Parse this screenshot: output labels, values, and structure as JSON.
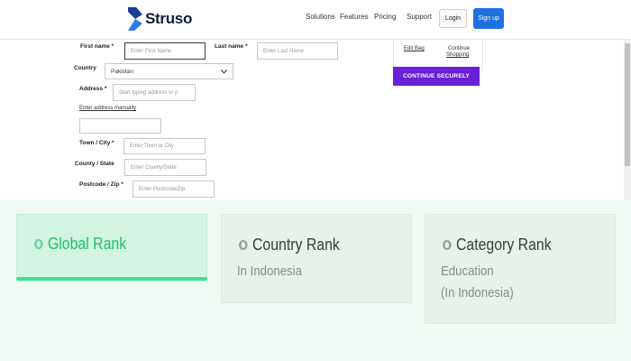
{
  "header": {
    "brand": "Struso",
    "nav": [
      "Solutions",
      "Features",
      "Pricing",
      "Support"
    ],
    "login_label": "Login",
    "signup_label": "Sign up"
  },
  "form": {
    "first_name": {
      "label": "First name *",
      "placeholder": "Enter First Name"
    },
    "last_name": {
      "label": "Last name *",
      "placeholder": "Enter Last Name"
    },
    "country": {
      "label": "Country",
      "value": "Pakistan"
    },
    "address": {
      "label": "Address *",
      "placeholder": "Start typing address or p"
    },
    "enter_manually": "Enter address manually",
    "town": {
      "label": "Town / City *",
      "placeholder": "Enter Town or City"
    },
    "county": {
      "label": "County / State",
      "placeholder": "Enter County/State"
    },
    "postcode": {
      "label": "Postcode / Zip *",
      "placeholder": "Enter Postcode/Zip"
    }
  },
  "summary": {
    "edit_bag": "Edit Bag",
    "continue_shopping_1": "Continue",
    "continue_shopping_2": "Shopping",
    "cta": "CONTINUE SECURELY"
  },
  "ranks": [
    {
      "title": "Global Rank",
      "sub1": "",
      "sub2": ""
    },
    {
      "title": "Country Rank",
      "sub1": "In Indonesia",
      "sub2": ""
    },
    {
      "title": "Category Rank",
      "sub1": "Education",
      "sub2": "(In Indonesia)"
    }
  ],
  "colors": {
    "accent": "#6a1fd8",
    "signup": "#1f6fe0",
    "rank_green": "#1fc26a"
  }
}
